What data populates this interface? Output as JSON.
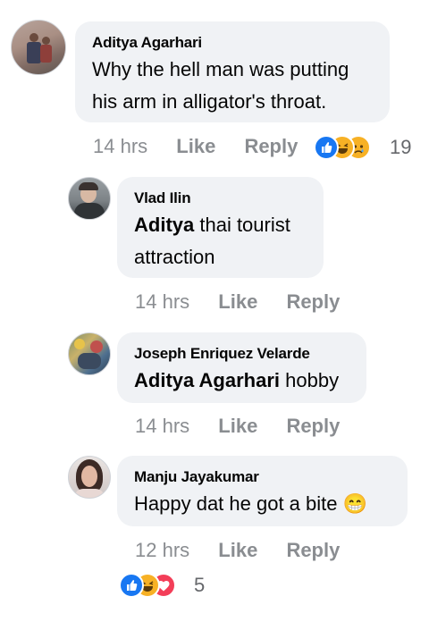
{
  "comments": [
    {
      "author": "Aditya Agarhari",
      "lines": [
        "Why the hell man was putting",
        "his arm in alligator's throat."
      ],
      "time": "14 hrs",
      "like": "Like",
      "reply": "Reply",
      "reaction_count": "19",
      "reactions": [
        "like-icon",
        "haha-icon",
        "sad-icon"
      ]
    },
    {
      "author": "Vlad Ilin",
      "mention": "Aditya",
      "text_after": " thai tourist",
      "line2": "attraction",
      "time": "14 hrs",
      "like": "Like",
      "reply": "Reply"
    },
    {
      "author": "Joseph Enriquez Velarde",
      "mention": "Aditya Agarhari",
      "text_after": " hobby",
      "time": "14 hrs",
      "like": "Like",
      "reply": "Reply"
    },
    {
      "author": "Manju Jayakumar",
      "text": "Happy dat he got a bite",
      "emoji": "😁",
      "time": "12 hrs",
      "like": "Like",
      "reply": "Reply",
      "reaction_count": "5",
      "reactions": [
        "like-icon",
        "haha-icon",
        "love-icon"
      ]
    }
  ],
  "colors": {
    "bubble": "#f0f2f5",
    "meta_gray": "#8a8d91",
    "like_blue": "#1877f2",
    "haha_yellow": "#f7b125",
    "love_red": "#f33e58"
  }
}
